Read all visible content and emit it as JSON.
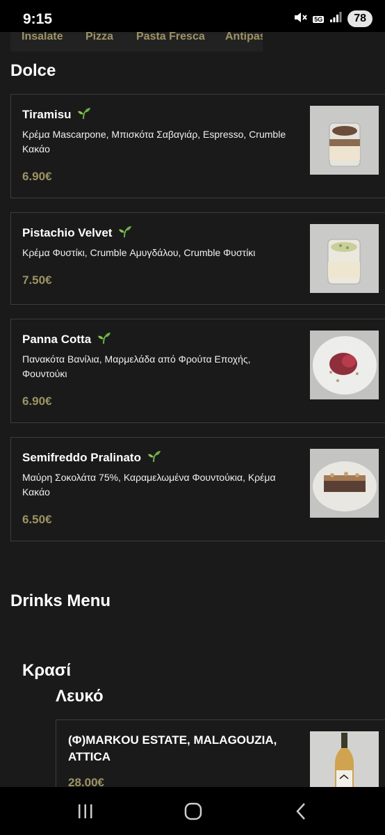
{
  "status_bar": {
    "time": "9:15",
    "network": "5G",
    "battery": "78"
  },
  "tabs": [
    "Insalate",
    "Pizza",
    "Pasta Fresca",
    "Antipas"
  ],
  "section_title": "Dolce",
  "desserts": [
    {
      "name": "Tiramisu",
      "description": "Κρέμα Mascarpone, Μπισκότα Σαβαγιάρ, Espresso, Crumble Κακάο",
      "price": "6.90€"
    },
    {
      "name": "Pistachio Velvet",
      "description": "Κρέμα Φυστίκι, Crumble Αμυγδάλου, Crumble Φυστίκι",
      "price": "7.50€"
    },
    {
      "name": "Panna Cotta",
      "description": "Πανακότα Βανίλια, Μαρμελάδα από Φρούτα Εποχής, Φουντούκι",
      "price": "6.90€"
    },
    {
      "name": "Semifreddo Pralinato",
      "description": "Μαύρη Σοκολάτα 75%, Καραμελωμένα Φουντούκια, Κρέμα Κακάο",
      "price": "6.50€"
    }
  ],
  "drinks": {
    "title": "Drinks Menu",
    "category": "Κρασί",
    "subcategory": "Λευκό",
    "items": [
      {
        "name": "(Φ)MARKOU ESTATE, MALAGOUZIA, ATTICA",
        "price": "28.00€"
      }
    ]
  },
  "colors": {
    "accent": "#9d9364",
    "background": "#1a1a1a",
    "border": "#3d3d3d"
  },
  "icons": {
    "vegan": "sprout-icon",
    "mute": "mute-icon",
    "signal": "signal-icon"
  }
}
